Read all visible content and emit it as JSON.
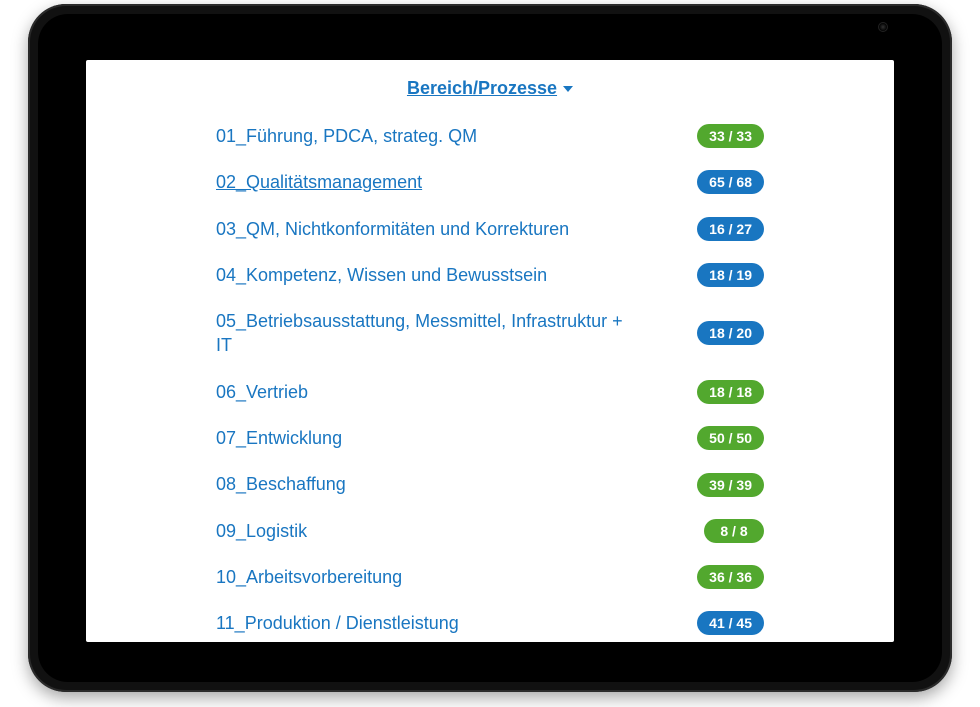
{
  "header": {
    "title": "Bereich/Prozesse"
  },
  "colors": {
    "green": "#52a82e",
    "blue": "#1976c1"
  },
  "rows": [
    {
      "label": "01_Führung, PDCA, strateg. QM",
      "badge": "33 / 33",
      "color": "green",
      "active": false
    },
    {
      "label": "02_Qualitätsmanagement",
      "badge": "65 / 68",
      "color": "blue",
      "active": true
    },
    {
      "label": "03_QM, Nichtkonformitäten und Korrekturen",
      "badge": "16 / 27",
      "color": "blue",
      "active": false
    },
    {
      "label": "04_Kompetenz, Wissen und Bewusstsein",
      "badge": "18 / 19",
      "color": "blue",
      "active": false
    },
    {
      "label": "05_Betriebsausstattung, Messmittel, Infrastruktur + IT",
      "badge": "18 / 20",
      "color": "blue",
      "active": false
    },
    {
      "label": "06_Vertrieb",
      "badge": "18 / 18",
      "color": "green",
      "active": false
    },
    {
      "label": "07_Entwicklung",
      "badge": "50 / 50",
      "color": "green",
      "active": false
    },
    {
      "label": "08_Beschaffung",
      "badge": "39 / 39",
      "color": "green",
      "active": false
    },
    {
      "label": "09_Logistik",
      "badge": "8 / 8",
      "color": "green",
      "active": false
    },
    {
      "label": "10_Arbeitsvorbereitung",
      "badge": "36 / 36",
      "color": "green",
      "active": false
    },
    {
      "label": "11_Produktion / Dienstleistung",
      "badge": "41 / 45",
      "color": "blue",
      "active": false
    }
  ]
}
